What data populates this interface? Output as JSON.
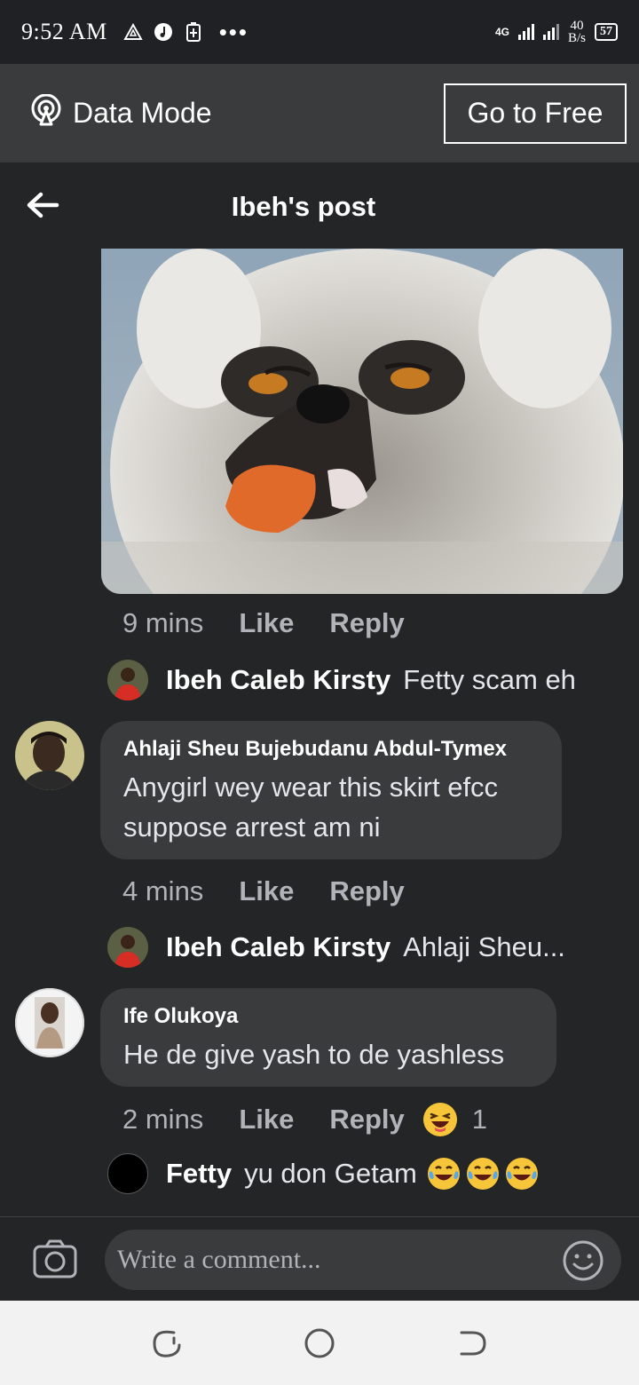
{
  "status": {
    "time": "9:52 AM",
    "network": "4G",
    "speed_value": "40",
    "speed_unit": "B/s",
    "battery": "57"
  },
  "data_bar": {
    "mode_label": "Data Mode",
    "go_free_label": "Go to Free"
  },
  "header": {
    "title": "Ibeh's post"
  },
  "comments": [
    {
      "time": "9 mins",
      "like": "Like",
      "reply": "Reply",
      "reply_preview": {
        "name": "Ibeh Caleb Kirsty",
        "text": "Fetty scam eh"
      }
    },
    {
      "author": "Ahlaji Sheu Bujebudanu Abdul-Tymex",
      "line1": "Anygirl wey wear this skirt efcc",
      "line2": "suppose arrest am ni",
      "time": "4 mins",
      "like": "Like",
      "reply": "Reply",
      "reply_preview": {
        "name": "Ibeh Caleb Kirsty",
        "text": "Ahlaji Sheu..."
      }
    },
    {
      "author": "Ife Olukoya",
      "line1": "He de give yash to de yashless",
      "time": "2 mins",
      "like": "Like",
      "reply": "Reply",
      "reaction_count": "1",
      "reply_preview": {
        "name": "Fetty",
        "text": "yu don Getam"
      }
    }
  ],
  "composer": {
    "placeholder": "Write a comment..."
  },
  "colors": {
    "background": "#242526",
    "bubble": "#3a3b3c",
    "secondary_text": "#b0b3b8"
  }
}
